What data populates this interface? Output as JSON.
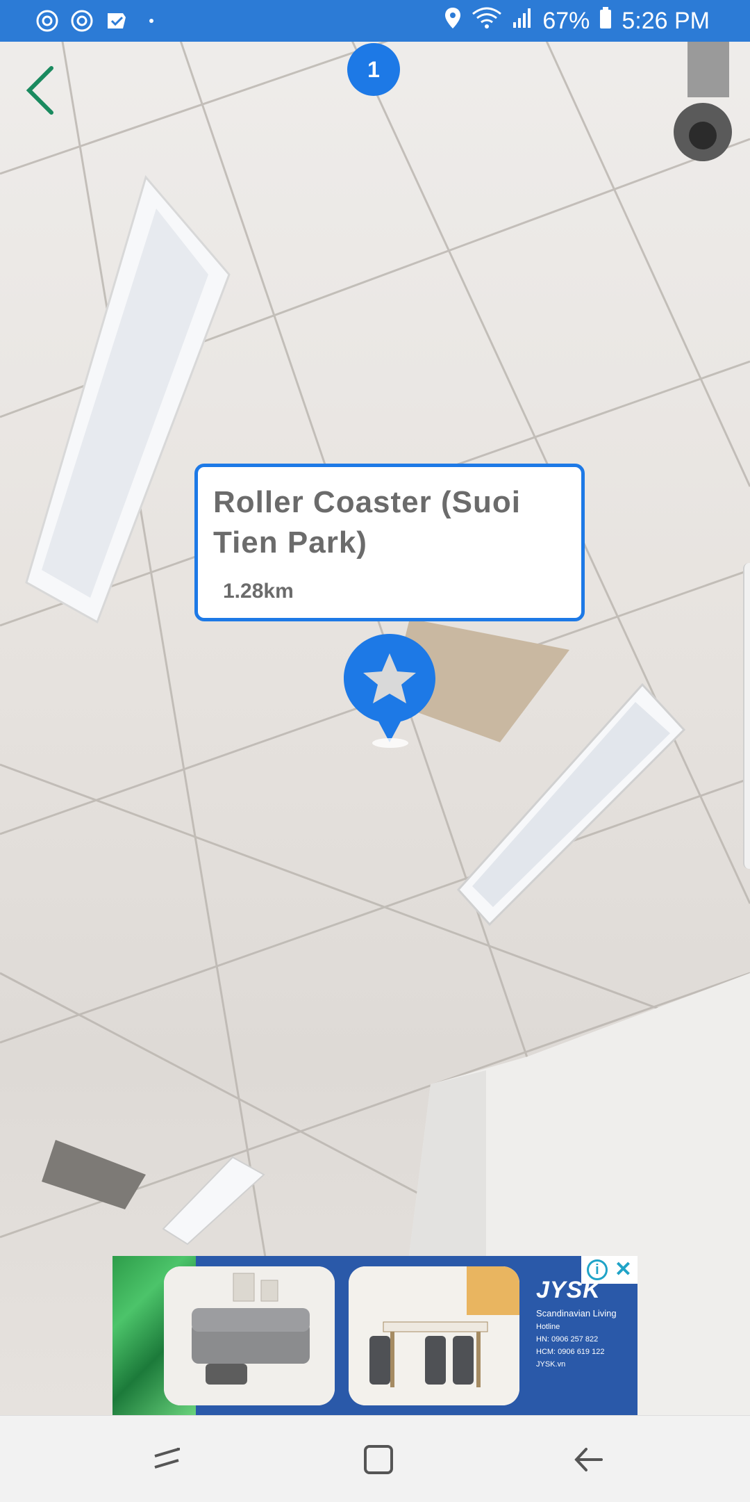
{
  "status_bar": {
    "battery": "67%",
    "time": "5:26 PM",
    "left_icons": [
      "sync-icon",
      "sync-icon",
      "checklist-icon",
      "dot-icon"
    ],
    "right_icons": [
      "location-icon",
      "wifi-icon",
      "signal-icon",
      "battery-icon"
    ]
  },
  "ar_view": {
    "counter": "1",
    "place": {
      "name": "Roller Coaster (Suoi Tien Park)",
      "distance": "1.28km",
      "marker_icon": "star-icon"
    }
  },
  "ad": {
    "brand": "JYSK",
    "tagline": "Scandinavian Living",
    "hotline_label": "Hotline",
    "hotline_hn": "HN: 0906 257 822",
    "hotline_hcm": "HCM: 0906 619 122",
    "website": "JYSK.vn"
  },
  "nav_bar": {
    "icons": [
      "recent-apps-icon",
      "home-icon",
      "back-icon"
    ]
  },
  "colors": {
    "accent": "#1d79e6",
    "status_bar": "#2c7bd6",
    "text_gray": "#6b6b6b"
  }
}
